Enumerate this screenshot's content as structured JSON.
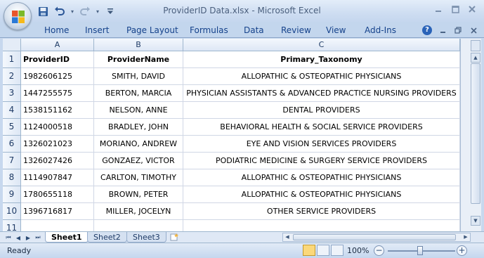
{
  "window": {
    "title": "ProviderID Data.xlsx - Microsoft Excel",
    "minimize_icon": "minimize-icon",
    "restore_icon": "restore-icon",
    "close_icon": "close-icon"
  },
  "qat": {
    "save_icon": "save-icon",
    "undo_icon": "undo-icon",
    "redo_icon": "redo-icon",
    "customize_icon": "qat-dropdown-icon",
    "dropdown_glyph": "▾"
  },
  "ribbon": {
    "tabs": [
      "Home",
      "Insert",
      "Page Layout",
      "Formulas",
      "Data",
      "Review",
      "View",
      "Add-Ins"
    ],
    "help_glyph": "?"
  },
  "sheet": {
    "columns": [
      "A",
      "B",
      "C"
    ],
    "row_numbers": [
      "1",
      "2",
      "3",
      "4",
      "5",
      "6",
      "7",
      "8",
      "9",
      "10",
      "11"
    ],
    "header": [
      "ProviderID",
      "ProviderName",
      "Primary_Taxonomy"
    ],
    "rows": [
      [
        "1982606125",
        "SMITH, DAVID",
        "ALLOPATHIC & OSTEOPATHIC PHYSICIANS"
      ],
      [
        "1447255575",
        "BERTON, MARCIA",
        "PHYSICIAN ASSISTANTS & ADVANCED PRACTICE NURSING PROVIDERS"
      ],
      [
        "1538151162",
        "NELSON, ANNE",
        "DENTAL PROVIDERS"
      ],
      [
        "1124000518",
        "BRADLEY, JOHN",
        "BEHAVIORAL HEALTH & SOCIAL SERVICE PROVIDERS"
      ],
      [
        "1326021023",
        "MORIANO, ANDREW",
        "EYE AND VISION SERVICES PROVIDERS"
      ],
      [
        "1326027426",
        "GONZAEZ, VICTOR",
        "PODIATRIC MEDICINE & SURGERY SERVICE PROVIDERS"
      ],
      [
        "1114907847",
        "CARLTON, TIMOTHY",
        "ALLOPATHIC & OSTEOPATHIC PHYSICIANS"
      ],
      [
        "1780655118",
        "BROWN, PETER",
        "ALLOPATHIC & OSTEOPATHIC PHYSICIANS"
      ],
      [
        "1396716817",
        "MILLER, JOCELYN",
        "OTHER SERVICE PROVIDERS"
      ]
    ]
  },
  "sheet_tabs": {
    "nav_glyphs": [
      "⏮",
      "◀",
      "▶",
      "⏭"
    ],
    "tabs": [
      "Sheet1",
      "Sheet2",
      "Sheet3"
    ],
    "active": "Sheet1",
    "insert_icon": "insert-worksheet-icon"
  },
  "status": {
    "text": "Ready",
    "zoom": "100%",
    "zoom_out_glyph": "−",
    "zoom_in_glyph": "+"
  }
}
